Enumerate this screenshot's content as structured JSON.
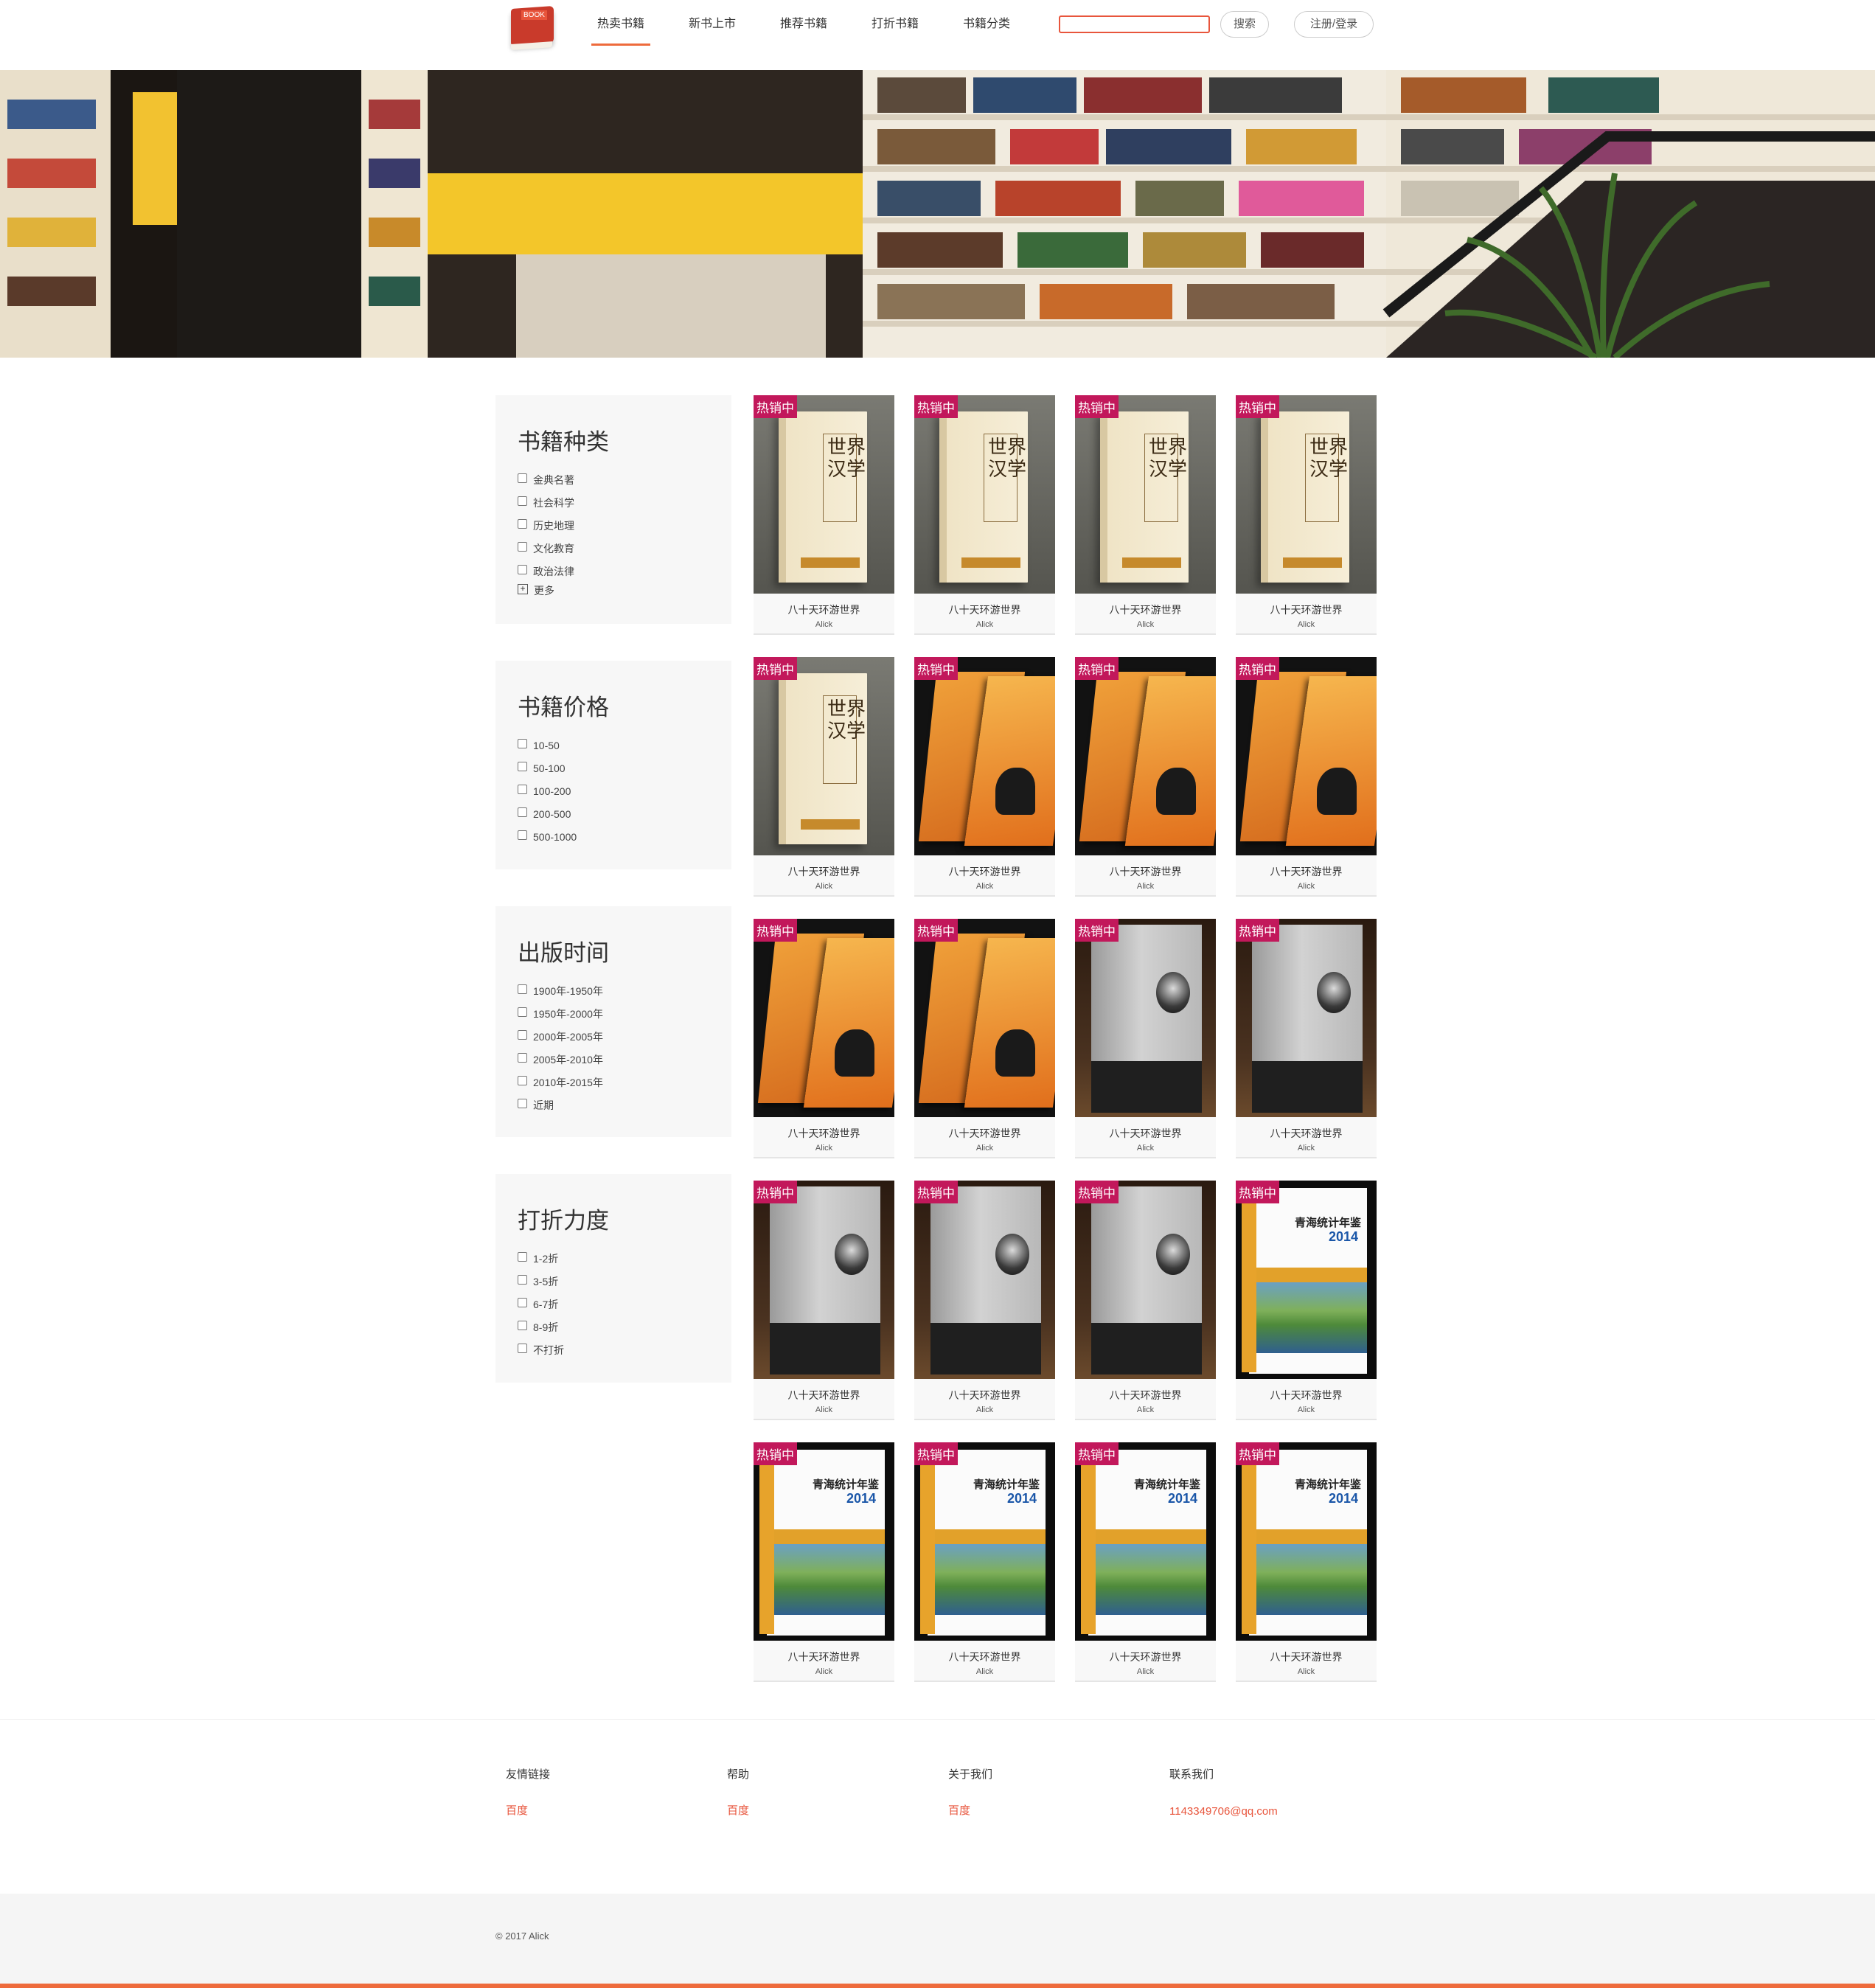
{
  "header": {
    "logo_text": "BOOK",
    "nav": [
      "热卖书籍",
      "新书上市",
      "推荐书籍",
      "打折书籍",
      "书籍分类"
    ],
    "search_placeholder": "",
    "search_button": "搜索",
    "login_button": "注册/登录"
  },
  "sidebar": {
    "categories": {
      "title": "书籍种类",
      "options": [
        "金典名著",
        "社会科学",
        "历史地理",
        "文化教育",
        "政治法律"
      ],
      "more": "更多"
    },
    "price": {
      "title": "书籍价格",
      "options": [
        "10-50",
        "50-100",
        "100-200",
        "200-500",
        "500-1000"
      ]
    },
    "date": {
      "title": "出版时间",
      "options": [
        "1900年-1950年",
        "1950年-2000年",
        "2000年-2005年",
        "2005年-2010年",
        "2010年-2015年",
        "近期"
      ]
    },
    "discount": {
      "title": "打折力度",
      "options": [
        "1-2折",
        "3-5折",
        "6-7折",
        "8-9折",
        "不打折"
      ]
    }
  },
  "books": [
    {
      "cover": "c1",
      "badge": "热销中",
      "title": "八十天环游世界",
      "author": "Alick"
    },
    {
      "cover": "c1",
      "badge": "热销中",
      "title": "八十天环游世界",
      "author": "Alick"
    },
    {
      "cover": "c1",
      "badge": "热销中",
      "title": "八十天环游世界",
      "author": "Alick"
    },
    {
      "cover": "c1",
      "badge": "热销中",
      "title": "八十天环游世界",
      "author": "Alick"
    },
    {
      "cover": "c1",
      "badge": "热销中",
      "title": "八十天环游世界",
      "author": "Alick"
    },
    {
      "cover": "c2",
      "badge": "热销中",
      "title": "八十天环游世界",
      "author": "Alick"
    },
    {
      "cover": "c2",
      "badge": "热销中",
      "title": "八十天环游世界",
      "author": "Alick"
    },
    {
      "cover": "c2",
      "badge": "热销中",
      "title": "八十天环游世界",
      "author": "Alick"
    },
    {
      "cover": "c2",
      "badge": "热销中",
      "title": "八十天环游世界",
      "author": "Alick"
    },
    {
      "cover": "c2",
      "badge": "热销中",
      "title": "八十天环游世界",
      "author": "Alick"
    },
    {
      "cover": "c3",
      "badge": "热销中",
      "title": "八十天环游世界",
      "author": "Alick"
    },
    {
      "cover": "c3",
      "badge": "热销中",
      "title": "八十天环游世界",
      "author": "Alick"
    },
    {
      "cover": "c3",
      "badge": "热销中",
      "title": "八十天环游世界",
      "author": "Alick"
    },
    {
      "cover": "c3",
      "badge": "热销中",
      "title": "八十天环游世界",
      "author": "Alick"
    },
    {
      "cover": "c3",
      "badge": "热销中",
      "title": "八十天环游世界",
      "author": "Alick"
    },
    {
      "cover": "c4",
      "badge": "热销中",
      "title": "八十天环游世界",
      "author": "Alick"
    },
    {
      "cover": "c4",
      "badge": "热销中",
      "title": "八十天环游世界",
      "author": "Alick"
    },
    {
      "cover": "c4",
      "badge": "热销中",
      "title": "八十天环游世界",
      "author": "Alick"
    },
    {
      "cover": "c4",
      "badge": "热销中",
      "title": "八十天环游世界",
      "author": "Alick"
    },
    {
      "cover": "c4",
      "badge": "热销中",
      "title": "八十天环游世界",
      "author": "Alick"
    }
  ],
  "cover_text": {
    "c1": "世界汉学",
    "c4_title": "青海统计年鉴",
    "c4_year": "2014"
  },
  "footer": {
    "links": {
      "title": "友情链接",
      "item": "百度"
    },
    "help": {
      "title": "帮助",
      "item": "百度"
    },
    "about": {
      "title": "关于我们",
      "item": "百度"
    },
    "contact": {
      "title": "联系我们",
      "item": "1143349706@qq.com"
    },
    "copyright": "© 2017 Alick"
  },
  "colors": {
    "accent": "#ee6b3c",
    "badge": "#c2185b",
    "link": "#e8553c"
  }
}
